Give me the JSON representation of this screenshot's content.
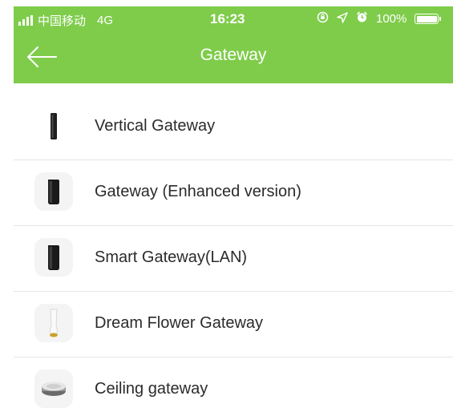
{
  "status_bar": {
    "carrier": "中国移动",
    "network": "4G",
    "time": "16:23",
    "battery": "100%",
    "battery_level": 1.0
  },
  "nav": {
    "title": "Gateway",
    "back_icon": "arrow-left-icon"
  },
  "colors": {
    "header": "#7fcc4b",
    "divider": "#e6e6e6",
    "text": "#2b2b2b"
  },
  "gateways": [
    {
      "label": "Vertical Gateway",
      "icon": "vertical-gateway-icon"
    },
    {
      "label": "Gateway (Enhanced version)",
      "icon": "enhanced-gateway-icon"
    },
    {
      "label": "Smart Gateway(LAN)",
      "icon": "smart-gateway-lan-icon"
    },
    {
      "label": "Dream Flower Gateway",
      "icon": "dream-flower-gateway-icon"
    },
    {
      "label": "Ceiling gateway",
      "icon": "ceiling-gateway-icon"
    }
  ]
}
